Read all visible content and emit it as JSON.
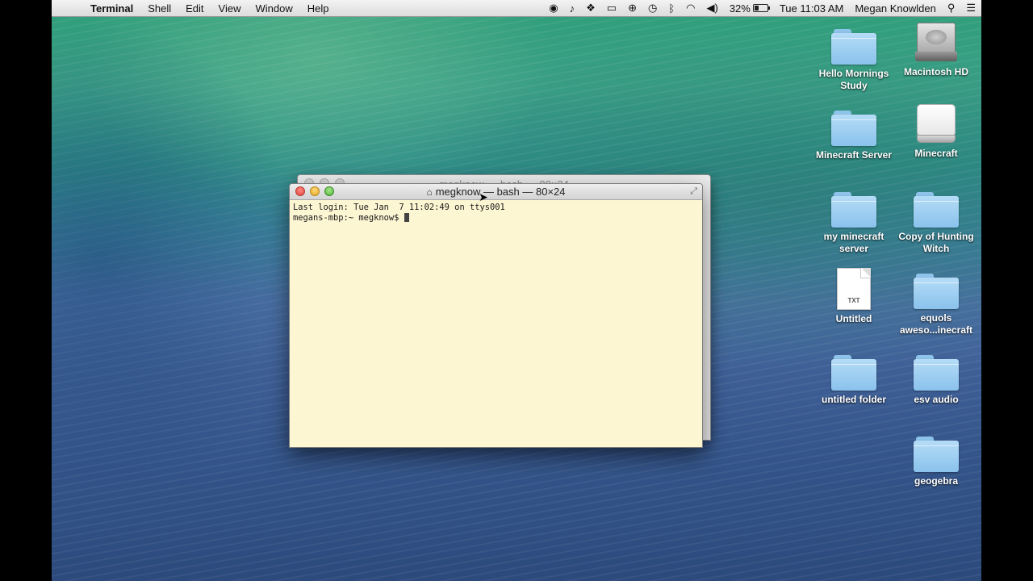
{
  "menubar": {
    "app_name": "Terminal",
    "menus": [
      "Shell",
      "Edit",
      "View",
      "Window",
      "Help"
    ],
    "battery_percent": "32%",
    "battery_level": 0.32,
    "clock": "Tue 11:03 AM",
    "user_name": "Megan Knowlden",
    "status_icons": [
      "screen-record-icon",
      "notification-bell-icon",
      "dropbox-icon",
      "airplay-icon",
      "accessibility-icon",
      "time-machine-icon",
      "bluetooth-icon",
      "wifi-icon",
      "volume-icon",
      "battery-icon",
      "spotlight-search-icon",
      "notification-center-list-icon"
    ]
  },
  "desktop_icons": [
    {
      "label": "Hello Mornings Study",
      "type": "folder"
    },
    {
      "label": "Macintosh HD",
      "type": "hard-drive"
    },
    {
      "label": "Minecraft Server",
      "type": "folder"
    },
    {
      "label": "Minecraft",
      "type": "drive"
    },
    {
      "label": "my minecraft server",
      "type": "folder"
    },
    {
      "label": "Copy of Hunting Witch",
      "type": "folder"
    },
    {
      "label": "Untitled",
      "type": "text-document",
      "badge": "TXT"
    },
    {
      "label": "equols aweso...inecraft",
      "type": "folder"
    },
    {
      "label": "untitled folder",
      "type": "folder"
    },
    {
      "label": "esv audio",
      "type": "folder"
    },
    {
      "label": "geogebra",
      "type": "folder"
    }
  ],
  "terminal_back": {
    "title": "megknow — bash — 80×24"
  },
  "terminal": {
    "title": "megknow — bash — 80×24",
    "lines": [
      "Last login: Tue Jan  7 11:02:49 on ttys001",
      "megans-mbp:~ megknow$ "
    ]
  }
}
